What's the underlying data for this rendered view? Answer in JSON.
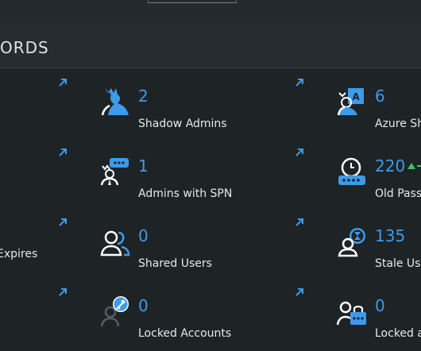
{
  "header": {
    "title": "ORDS"
  },
  "cards": [
    {
      "count": "2",
      "label": "Shadow Admins"
    },
    {
      "count": "6",
      "label": "Azure Sh"
    },
    {
      "count": "1",
      "label": "Admins with SPN"
    },
    {
      "count": "220",
      "label": "Old Pass"
    },
    {
      "label": "Expires"
    },
    {
      "count": "0",
      "label": "Shared Users"
    },
    {
      "count": "135",
      "label": "Stale Use"
    },
    {
      "count": "0",
      "label": "Locked Accounts"
    },
    {
      "count": "0",
      "label": "Locked a"
    }
  ],
  "colors": {
    "accent": "#3d9be9",
    "background": "#1e2326",
    "trend_up": "#3fbf6a"
  },
  "icons": [
    "open-link-icon",
    "shadow-admin-icon",
    "azure-admin-icon",
    "admin-spn-icon",
    "old-password-icon",
    "shared-users-icon",
    "stale-user-icon",
    "locked-account-icon",
    "locked-admin-icon",
    "trend-up-icon"
  ]
}
